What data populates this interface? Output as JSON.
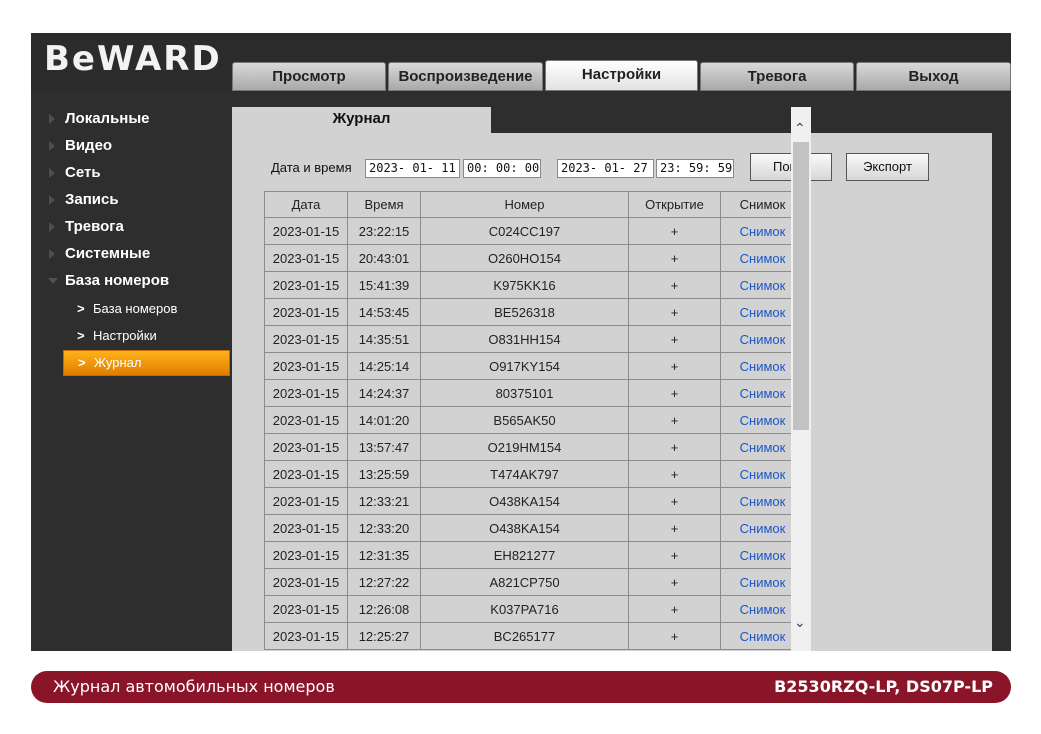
{
  "logo": "BeWARD",
  "tabs": [
    "Просмотр",
    "Воспроизведение",
    "Настройки",
    "Тревога",
    "Выход"
  ],
  "active_tab": "Настройки",
  "sidebar": {
    "items": [
      "Локальные",
      "Видео",
      "Сеть",
      "Запись",
      "Тревога",
      "Системные",
      "База номеров"
    ],
    "subitems": [
      "База номеров",
      "Настройки",
      "Журнал"
    ],
    "active_subitem": "Журнал"
  },
  "content": {
    "tab_title": "Журнал",
    "filter_label": "Дата и время",
    "start": {
      "date": "2023- 01- 11",
      "time": "00: 00: 00"
    },
    "end": {
      "date": "2023- 01- 27",
      "time": "23: 59: 59"
    },
    "search_button": "Поиск",
    "export_button": "Экспорт"
  },
  "table": {
    "headers": [
      "Дата",
      "Время",
      "Номер",
      "Открытие",
      "Снимок"
    ],
    "rows": [
      [
        "2023-01-15",
        "23:22:15",
        "C024CC197",
        "+",
        "Снимок"
      ],
      [
        "2023-01-15",
        "20:43:01",
        "O260HO154",
        "+",
        "Снимок"
      ],
      [
        "2023-01-15",
        "15:41:39",
        "K975KK16",
        "+",
        "Снимок"
      ],
      [
        "2023-01-15",
        "14:53:45",
        "BE526318",
        "+",
        "Снимок"
      ],
      [
        "2023-01-15",
        "14:35:51",
        "O831HH154",
        "+",
        "Снимок"
      ],
      [
        "2023-01-15",
        "14:25:14",
        "O917KY154",
        "+",
        "Снимок"
      ],
      [
        "2023-01-15",
        "14:24:37",
        "80375101",
        "+",
        "Снимок"
      ],
      [
        "2023-01-15",
        "14:01:20",
        "B565AK50",
        "+",
        "Снимок"
      ],
      [
        "2023-01-15",
        "13:57:47",
        "O219HM154",
        "+",
        "Снимок"
      ],
      [
        "2023-01-15",
        "13:25:59",
        "T474AK797",
        "+",
        "Снимок"
      ],
      [
        "2023-01-15",
        "12:33:21",
        "O438KA154",
        "+",
        "Снимок"
      ],
      [
        "2023-01-15",
        "12:33:20",
        "O438KA154",
        "+",
        "Снимок"
      ],
      [
        "2023-01-15",
        "12:31:35",
        "EH821277",
        "+",
        "Снимок"
      ],
      [
        "2023-01-15",
        "12:27:22",
        "A821CP750",
        "+",
        "Снимок"
      ],
      [
        "2023-01-15",
        "12:26:08",
        "K037PA716",
        "+",
        "Снимок"
      ],
      [
        "2023-01-15",
        "12:25:27",
        "BC265177",
        "+",
        "Снимок"
      ]
    ]
  },
  "footer": {
    "left": "Журнал автомобильных номеров",
    "right": "B2530RZQ-LP, DS07P-LP"
  },
  "colors": {
    "accent": "#f39a0c",
    "footer_bg": "#8b1528",
    "link": "#1a56c8"
  }
}
